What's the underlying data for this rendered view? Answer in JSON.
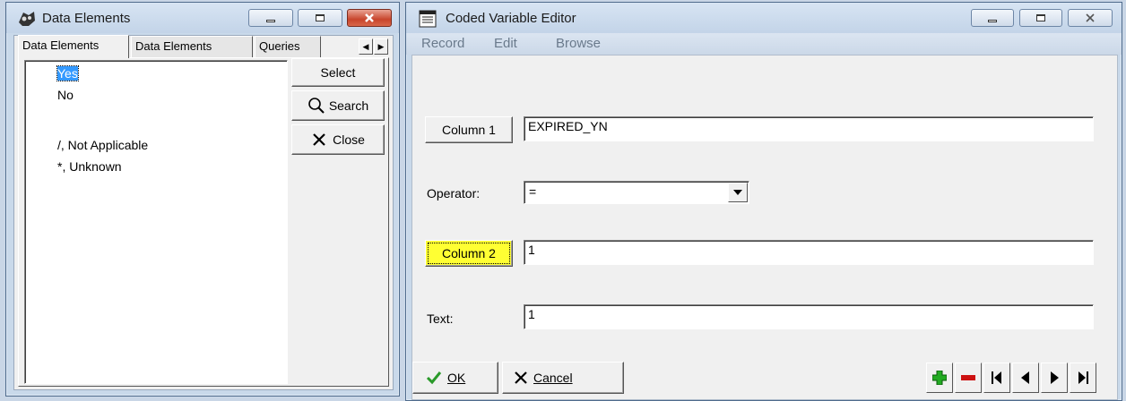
{
  "left_window": {
    "title": "Data Elements",
    "tabs": [
      "Data Elements",
      "Data Elements",
      "Queries"
    ],
    "list_items": [
      {
        "label": "Yes",
        "selected": true
      },
      {
        "label": "No",
        "selected": false
      },
      {
        "label": "/, Not Applicable",
        "selected": false
      },
      {
        "label": "*, Unknown",
        "selected": false
      }
    ],
    "buttons": {
      "select": "Select",
      "search": "Search",
      "close": "Close"
    }
  },
  "right_window": {
    "title": "Coded Variable Editor",
    "menu": [
      "Record",
      "Edit",
      "Browse"
    ],
    "column1": {
      "button": "Column 1",
      "value": "EXPIRED_YN"
    },
    "operator": {
      "label": "Operator:",
      "value": "="
    },
    "column2": {
      "button": "Column 2",
      "value": "1",
      "highlight_color": "#ffff33"
    },
    "text": {
      "label": "Text:",
      "value": "1"
    },
    "footer": {
      "ok": "OK",
      "cancel": "Cancel"
    }
  },
  "colors": {
    "selection": "#3399ff",
    "add_icon": "#22aa22",
    "remove_icon": "#cc1111",
    "ok_check": "#2a9a2a"
  }
}
